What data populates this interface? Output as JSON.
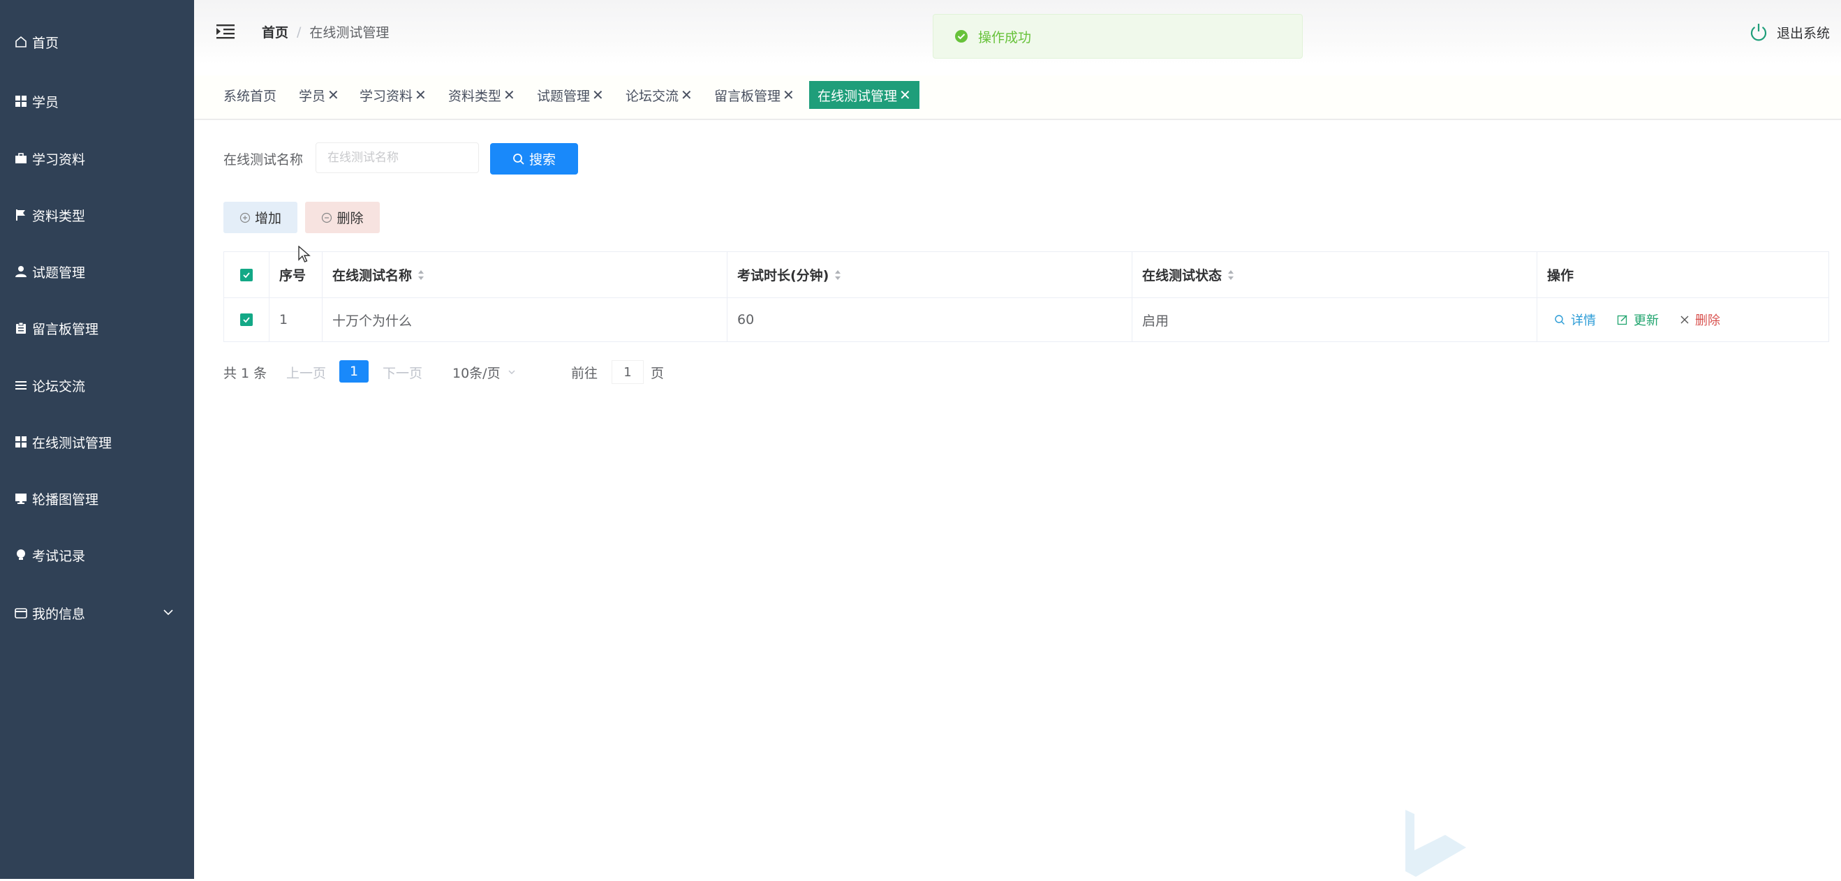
{
  "sidebar": {
    "items": [
      {
        "label": "首页",
        "icon": "home-icon"
      },
      {
        "label": "学员",
        "icon": "grid-icon"
      },
      {
        "label": "学习资料",
        "icon": "briefcase-icon"
      },
      {
        "label": "资料类型",
        "icon": "flag-icon"
      },
      {
        "label": "试题管理",
        "icon": "user-icon"
      },
      {
        "label": "留言板管理",
        "icon": "clipboard-icon"
      },
      {
        "label": "论坛交流",
        "icon": "list-icon"
      },
      {
        "label": "在线测试管理",
        "icon": "grid-icon"
      },
      {
        "label": "轮播图管理",
        "icon": "monitor-icon"
      },
      {
        "label": "考试记录",
        "icon": "bulb-icon"
      },
      {
        "label": "我的信息",
        "icon": "wallet-icon"
      }
    ]
  },
  "header": {
    "breadcrumb": {
      "home": "首页",
      "separator": "/",
      "current": "在线测试管理"
    },
    "toast": "操作成功",
    "logout": "退出系统"
  },
  "tags": [
    {
      "label": "系统首页",
      "closable": false
    },
    {
      "label": "学员",
      "closable": true
    },
    {
      "label": "学习资料",
      "closable": true
    },
    {
      "label": "资料类型",
      "closable": true
    },
    {
      "label": "试题管理",
      "closable": true
    },
    {
      "label": "论坛交流",
      "closable": true
    },
    {
      "label": "留言板管理",
      "closable": true
    },
    {
      "label": "在线测试管理",
      "closable": true,
      "active": true
    }
  ],
  "tag_close": "✕",
  "search": {
    "label": "在线测试名称",
    "placeholder": "在线测试名称",
    "value": "",
    "button": "搜索"
  },
  "actions": {
    "add": "增加",
    "delete": "删除"
  },
  "table": {
    "headers": {
      "index": "序号",
      "name": "在线测试名称",
      "duration": "考试时长(分钟)",
      "status": "在线测试状态",
      "ops": "操作"
    },
    "rows": [
      {
        "index": "1",
        "name": "十万个为什么",
        "duration": "60",
        "status": "启用",
        "checked": true
      }
    ],
    "ops": {
      "detail": "详情",
      "update": "更新",
      "delete": "删除"
    }
  },
  "pagination": {
    "total": "共 1 条",
    "prev": "上一页",
    "page": "1",
    "next": "下一页",
    "page_size": "10条/页",
    "goto": "前往",
    "goto_value": "1",
    "unit": "页"
  },
  "colors": {
    "sidebar": "#304156",
    "primary": "#1989fa",
    "active_tag": "#1f9e7a",
    "checkbox": "#13a886",
    "success": "#67c23a"
  }
}
